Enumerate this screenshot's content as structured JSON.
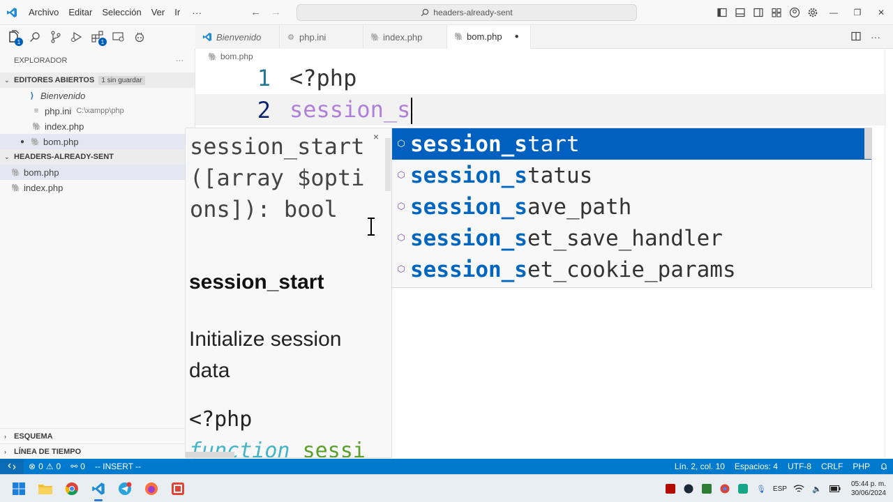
{
  "menubar": {
    "items": [
      "Archivo",
      "Editar",
      "Selección",
      "Ver",
      "Ir"
    ],
    "more": "···",
    "search_text": "headers-already-sent"
  },
  "sidebar": {
    "title": "EXPLORADOR",
    "more": "···",
    "open_editors": {
      "label": "EDITORES ABIERTOS",
      "badge": "1 sin guardar",
      "items": [
        {
          "label": "Bienvenido",
          "extra": ""
        },
        {
          "label": "php.ini",
          "extra": "C:\\xampp\\php"
        },
        {
          "label": "index.php",
          "extra": ""
        },
        {
          "label": "bom.php",
          "extra": ""
        }
      ]
    },
    "folder": {
      "label": "HEADERS-ALREADY-SENT",
      "items": [
        {
          "label": "bom.php"
        },
        {
          "label": "index.php"
        }
      ]
    },
    "bottom": {
      "outline": "ESQUEMA",
      "timeline": "LÍNEA DE TIEMPO"
    },
    "activity_badges": {
      "explorer": "1",
      "extensions": "1"
    }
  },
  "tabs": [
    {
      "label": "Bienvenido",
      "icon": "vscode-icon"
    },
    {
      "label": "php.ini",
      "icon": "settings-file-icon"
    },
    {
      "label": "index.php",
      "icon": "php-file-icon"
    },
    {
      "label": "bom.php",
      "icon": "php-file-icon",
      "dirty": "●"
    }
  ],
  "editor": {
    "breadcrumb": "bom.php",
    "lines": [
      {
        "number": "1",
        "text": "<?php"
      },
      {
        "number": "2",
        "text": "session_s"
      }
    ]
  },
  "docs": {
    "signature": "session_start([array $options]): bool",
    "close": "×",
    "name": "session_start",
    "description": "Initialize session data",
    "code_line1": "<?php",
    "code_kw": "function",
    "code_fn": "sessi"
  },
  "suggestions": {
    "prefix": "session_s",
    "items": [
      {
        "prefix": "session_s",
        "rest": "tart"
      },
      {
        "prefix": "session_s",
        "rest": "tatus"
      },
      {
        "prefix": "session_s",
        "rest": "ave_path"
      },
      {
        "prefix": "session_s",
        "rest": "et_save_handler"
      },
      {
        "prefix": "session_s",
        "rest": "et_cookie_params"
      }
    ]
  },
  "statusbar": {
    "errors": "0",
    "warnings": "0",
    "ports": "0",
    "mode": "-- INSERT --",
    "position": "Lín. 2, col. 10",
    "spaces": "Espacios: 4",
    "encoding": "UTF-8",
    "eol": "CRLF",
    "language": "PHP"
  },
  "taskbar": {
    "lang": "ESP",
    "time": "05:44 p. m.",
    "date": "30/06/2024"
  },
  "colors": {
    "accent": "#007acc",
    "selection": "#0060c0",
    "php_icon": "#8c5fa8"
  }
}
